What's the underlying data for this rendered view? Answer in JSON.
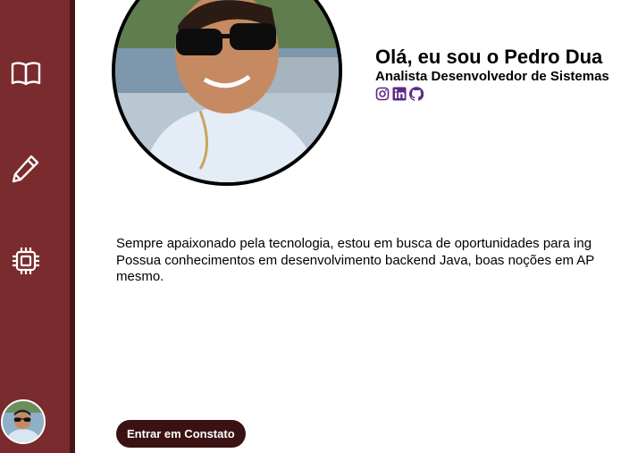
{
  "sidebar": {
    "items": [
      {
        "icon": "book-icon"
      },
      {
        "icon": "pencil-icon"
      },
      {
        "icon": "cpu-chip-icon"
      }
    ],
    "profile_avatar": "avatar"
  },
  "profile": {
    "greeting": "Olá, eu sou o Pedro Dua",
    "role": "Analista Desenvolvedor de Sistemas",
    "socials": [
      {
        "icon": "instagram-icon"
      },
      {
        "icon": "linkedin-icon"
      },
      {
        "icon": "github-icon"
      }
    ]
  },
  "bio": {
    "line1": "Sempre apaixonado pela tecnologia, estou em busca de oportunidades para ing",
    "line2": "Possua conhecimentos em desenvolvimento backend Java, boas noções em AP",
    "line3": "mesmo."
  },
  "cta": {
    "label": "Entrar em Constato"
  },
  "colors": {
    "sidebar": "#7a2b2e",
    "sidebar_border": "#4a1518",
    "button": "#3b1214",
    "social": "#5b2a86"
  }
}
